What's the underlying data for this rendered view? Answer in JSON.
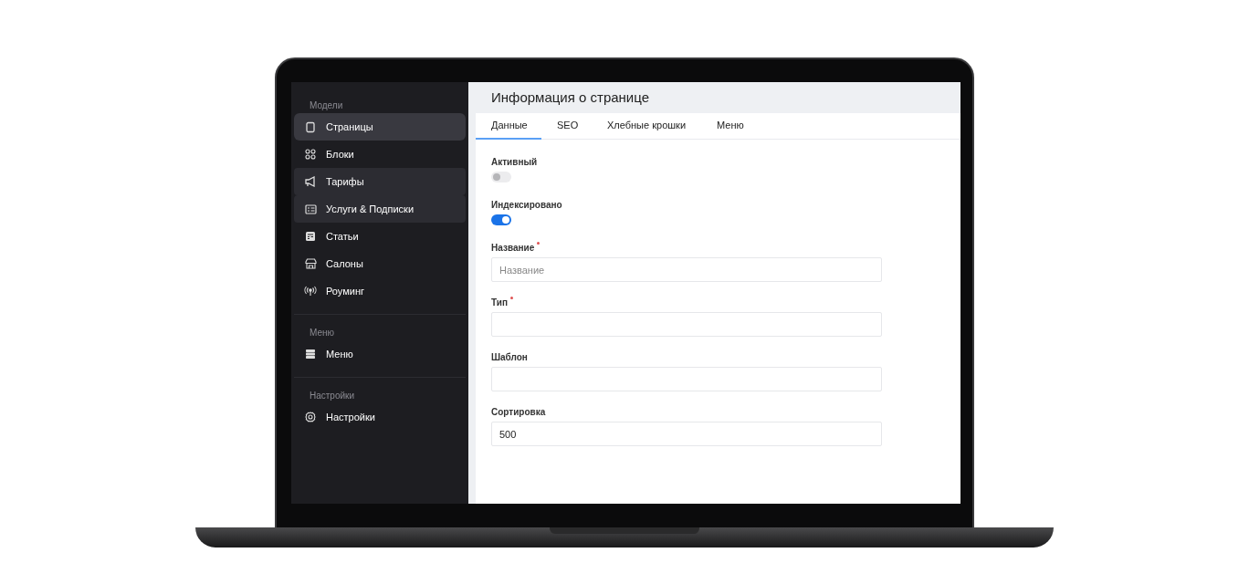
{
  "sidebar": {
    "groups": [
      {
        "title": "Модели",
        "items": [
          {
            "label": "Страницы",
            "selected": true,
            "hovered": false
          },
          {
            "label": "Блоки",
            "selected": false,
            "hovered": false
          },
          {
            "label": "Тарифы",
            "selected": false,
            "hovered": true
          },
          {
            "label": "Услуги & Подписки",
            "selected": false,
            "hovered": true
          },
          {
            "label": "Статьи",
            "selected": false,
            "hovered": false
          },
          {
            "label": "Салоны",
            "selected": false,
            "hovered": false
          },
          {
            "label": "Роуминг",
            "selected": false,
            "hovered": false
          }
        ]
      },
      {
        "title": "Меню",
        "items": [
          {
            "label": "Меню",
            "selected": false,
            "hovered": false
          }
        ]
      },
      {
        "title": "Настройки",
        "items": [
          {
            "label": "Настройки",
            "selected": false,
            "hovered": false
          }
        ]
      }
    ]
  },
  "header": {
    "title": "Информация о странице"
  },
  "tabs": [
    {
      "label": "Данные",
      "selected": true
    },
    {
      "label": "SEO",
      "selected": false
    },
    {
      "label": "Хлебные крошки",
      "selected": false
    },
    {
      "label": "Меню",
      "selected": false
    }
  ],
  "fields": [
    {
      "kind": "toggle",
      "label": "Активный",
      "on": false
    },
    {
      "kind": "toggle",
      "label": "Индексировано",
      "on": true
    },
    {
      "kind": "text",
      "label": "Название",
      "required": true,
      "placeholder": "Название"
    },
    {
      "kind": "text",
      "label": "Тип",
      "required": true
    },
    {
      "kind": "text",
      "label": "Шаблон",
      "required": false
    },
    {
      "kind": "text",
      "label": "Сортировка",
      "required": false,
      "value": "500"
    }
  ]
}
